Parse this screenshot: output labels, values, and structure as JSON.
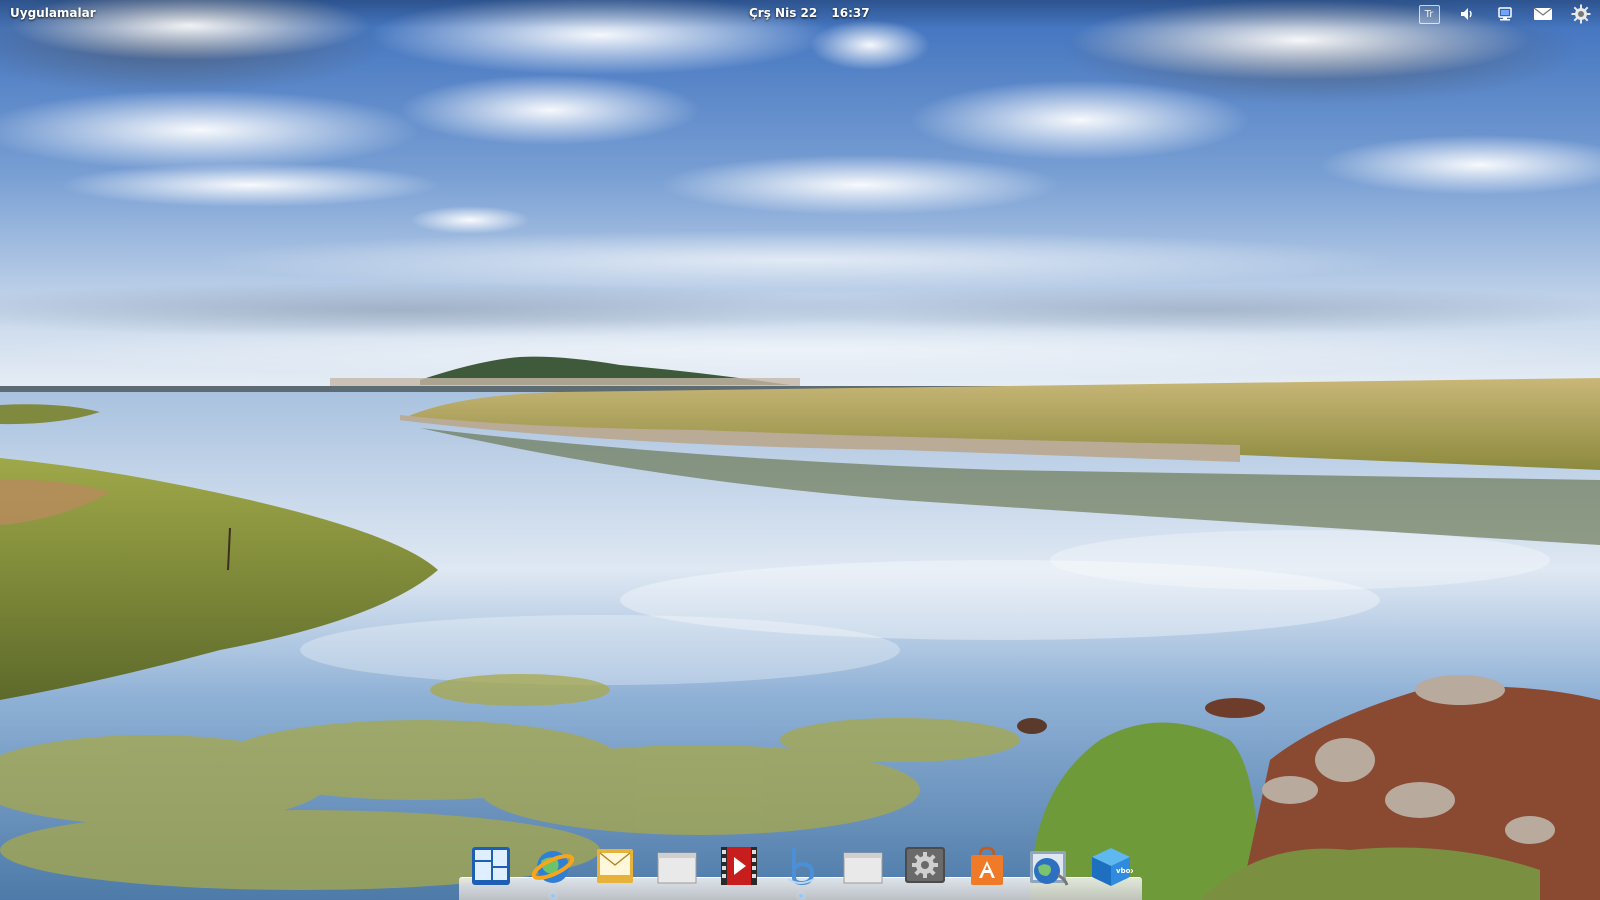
{
  "top_panel": {
    "apps_menu_label": "Uygulamalar",
    "clock": {
      "date": "Çrş Nis 22",
      "time": "16:37"
    },
    "indicators": [
      {
        "name": "keyboard-layout-indicator",
        "label": "Tr"
      },
      {
        "name": "volume-icon"
      },
      {
        "name": "network-icon"
      },
      {
        "name": "mail-icon"
      },
      {
        "name": "session-gear-icon"
      }
    ]
  },
  "dock": {
    "items": [
      {
        "name": "multitasking-view-icon",
        "running": false
      },
      {
        "name": "web-browser-icon",
        "running": true
      },
      {
        "name": "mail-client-icon",
        "running": false
      },
      {
        "name": "blank-window-icon",
        "running": false
      },
      {
        "name": "video-player-icon",
        "running": false
      },
      {
        "name": "b-app-icon",
        "running": true
      },
      {
        "name": "blank-window-icon-2",
        "running": false
      },
      {
        "name": "system-settings-icon",
        "running": false
      },
      {
        "name": "software-center-icon",
        "running": false
      },
      {
        "name": "globe-folder-icon",
        "running": false
      },
      {
        "name": "virtualbox-icon",
        "label": "vbox",
        "running": false
      }
    ]
  },
  "colors": {
    "sky_top": "#3f74c0",
    "sky_horizon": "#e6eef7",
    "water": "#7ea2c9",
    "grass": "#9b9a4a",
    "dock_shelf": "#e8e8e8"
  }
}
